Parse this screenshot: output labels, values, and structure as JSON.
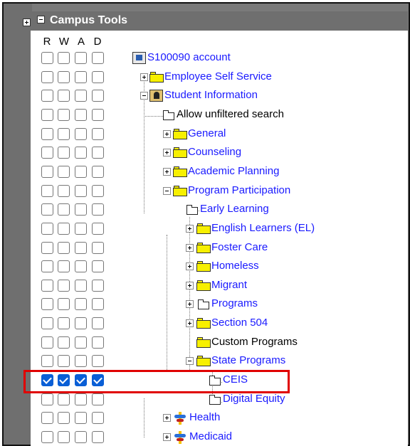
{
  "header": {
    "title": "Campus Tools"
  },
  "columns": [
    "R",
    "W",
    "A",
    "D"
  ],
  "tree": [
    {
      "label": "S100090 account",
      "color": "blue",
      "icon": "account-icon",
      "checked": [
        false,
        false,
        false,
        false
      ]
    },
    {
      "label": "Employee Self Service",
      "color": "blue",
      "icon": "folder-icon",
      "toggle": "plus",
      "checked": [
        false,
        false,
        false,
        false
      ]
    },
    {
      "label": "Student Information",
      "color": "blue",
      "icon": "student-icon",
      "toggle": "minus",
      "checked": [
        false,
        false,
        false,
        false
      ]
    },
    {
      "label": "Allow unfiltered search",
      "color": "black",
      "icon": "document-icon",
      "checked": [
        false,
        false,
        false,
        false
      ]
    },
    {
      "label": "General",
      "color": "blue",
      "icon": "folder-icon",
      "toggle": "plus",
      "checked": [
        false,
        false,
        false,
        false
      ]
    },
    {
      "label": "Counseling",
      "color": "blue",
      "icon": "folder-icon",
      "toggle": "plus",
      "checked": [
        false,
        false,
        false,
        false
      ]
    },
    {
      "label": "Academic Planning",
      "color": "blue",
      "icon": "folder-icon",
      "toggle": "plus",
      "checked": [
        false,
        false,
        false,
        false
      ]
    },
    {
      "label": "Program Participation",
      "color": "blue",
      "icon": "folder-icon",
      "toggle": "minus",
      "checked": [
        false,
        false,
        false,
        false
      ]
    },
    {
      "label": "Early Learning",
      "color": "blue",
      "icon": "document-icon",
      "checked": [
        false,
        false,
        false,
        false
      ]
    },
    {
      "label": "English Learners (EL)",
      "color": "blue",
      "icon": "folder-icon",
      "toggle": "plus",
      "checked": [
        false,
        false,
        false,
        false
      ]
    },
    {
      "label": "Foster Care",
      "color": "blue",
      "icon": "folder-icon",
      "toggle": "plus",
      "checked": [
        false,
        false,
        false,
        false
      ]
    },
    {
      "label": "Homeless",
      "color": "blue",
      "icon": "folder-icon",
      "toggle": "plus",
      "checked": [
        false,
        false,
        false,
        false
      ]
    },
    {
      "label": "Migrant",
      "color": "blue",
      "icon": "folder-icon",
      "toggle": "plus",
      "checked": [
        false,
        false,
        false,
        false
      ]
    },
    {
      "label": "Programs",
      "color": "blue",
      "icon": "document-icon",
      "toggle": "plus",
      "checked": [
        false,
        false,
        false,
        false
      ]
    },
    {
      "label": "Section 504",
      "color": "blue",
      "icon": "folder-icon",
      "toggle": "plus",
      "checked": [
        false,
        false,
        false,
        false
      ]
    },
    {
      "label": "Custom Programs",
      "color": "black",
      "icon": "folder-icon",
      "checked": [
        false,
        false,
        false,
        false
      ]
    },
    {
      "label": "State Programs",
      "color": "blue",
      "icon": "folder-icon",
      "toggle": "minus",
      "checked": [
        false,
        false,
        false,
        false
      ]
    },
    {
      "label": "CEIS",
      "color": "blue",
      "icon": "document-icon",
      "checked": [
        true,
        true,
        true,
        true
      ]
    },
    {
      "label": "Digital Equity",
      "color": "blue",
      "icon": "document-icon",
      "checked": [
        false,
        false,
        false,
        false
      ]
    },
    {
      "label": "Health",
      "color": "blue",
      "icon": "health-icon",
      "toggle": "plus",
      "checked": [
        false,
        false,
        false,
        false
      ]
    },
    {
      "label": "Medicaid",
      "color": "blue",
      "icon": "health-icon",
      "toggle": "plus",
      "checked": [
        false,
        false,
        false,
        false
      ]
    }
  ],
  "colors": {
    "check_blue": "#0a5fd6",
    "link_blue": "#1a1aff",
    "highlight_red": "#e00000",
    "folder_yellow": "#f7f000"
  }
}
